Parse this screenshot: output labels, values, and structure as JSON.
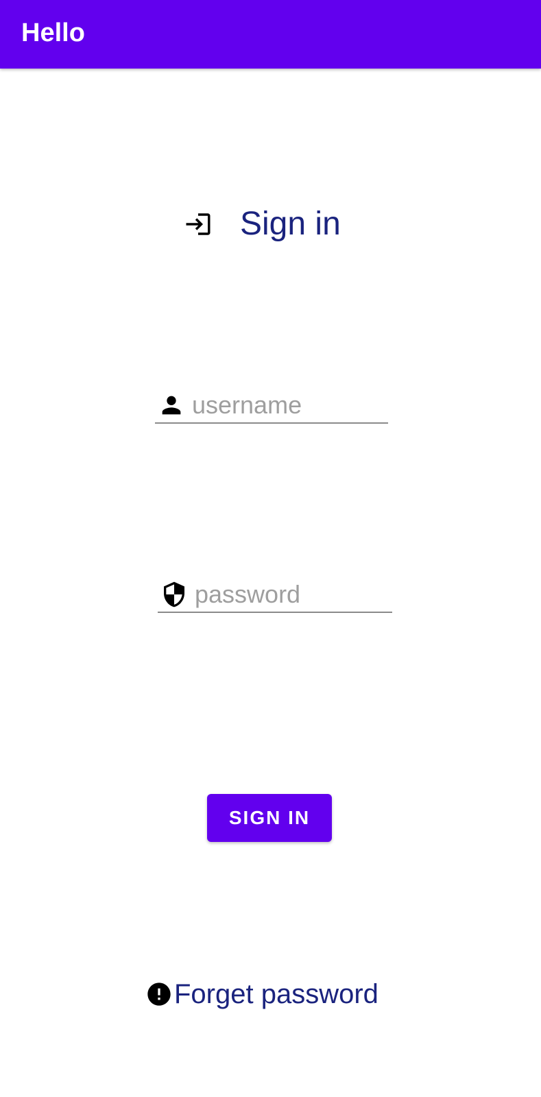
{
  "app_bar": {
    "title": "Hello",
    "color": "#6200EE"
  },
  "signin_header": {
    "icon": "login-icon",
    "title": "Sign in"
  },
  "username_field": {
    "icon": "person-icon",
    "placeholder": "username",
    "value": ""
  },
  "password_field": {
    "icon": "security-shield-icon",
    "placeholder": "password",
    "value": ""
  },
  "signin_button": {
    "label": "SIGN IN",
    "color": "#6200EE"
  },
  "forget_link": {
    "icon": "error-icon",
    "label": "Forget password"
  },
  "colors": {
    "primary": "#6200EE",
    "text_accent": "#1A237E",
    "placeholder": "#9E9E9E"
  }
}
